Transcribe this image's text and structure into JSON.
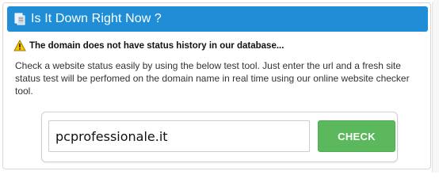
{
  "header": {
    "title": "Is It Down Right Now ?",
    "icon": "server-icon",
    "background_color": "#1f8ed6"
  },
  "warning": {
    "icon": "warning-icon",
    "text": "The domain does not have status history in our database..."
  },
  "description": "Check a website status easily by using the below test tool. Just enter the url and a fresh site status test will be perfomed on the domain name in real time using our online website checker tool.",
  "test_tool": {
    "url_value": "pcprofessionale.it",
    "check_label": "CHECK",
    "check_color": "#5cb85c"
  }
}
